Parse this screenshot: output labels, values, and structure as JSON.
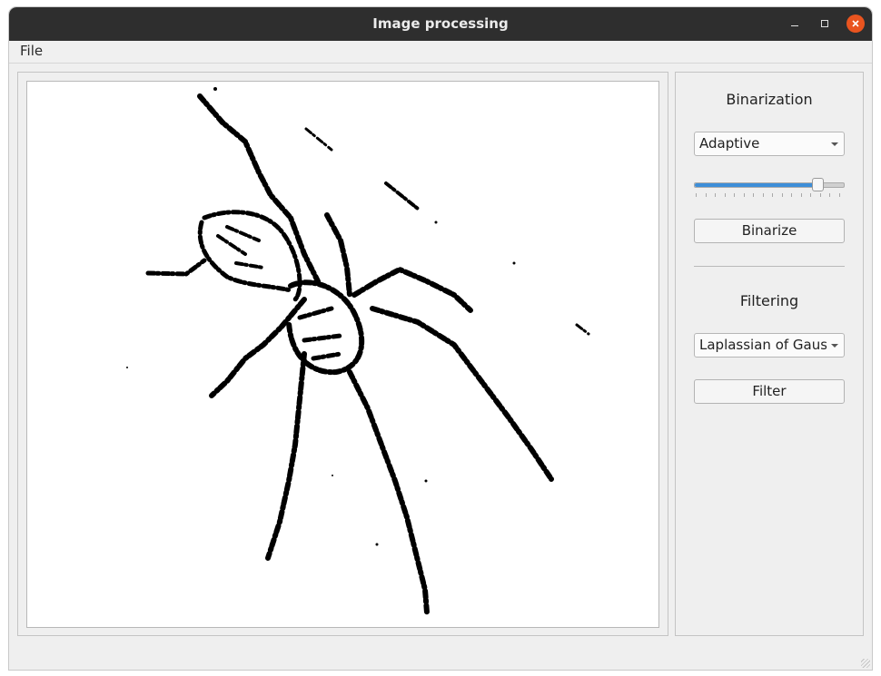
{
  "window": {
    "title": "Image processing",
    "controls": [
      "minimize-icon",
      "maximize-icon",
      "close-icon"
    ],
    "close_color": "#e9541f"
  },
  "menu": {
    "file_label": "File"
  },
  "binarization": {
    "title": "Binarization",
    "method": "Adaptive",
    "threshold_fraction": 0.83,
    "button_label": "Binarize"
  },
  "filtering": {
    "title": "Filtering",
    "method": "Laplassian of Gauss",
    "button_label": "Filter"
  },
  "colors": {
    "slider_accent": "#3d8ed8",
    "titlebar": "#2e2e2e"
  }
}
